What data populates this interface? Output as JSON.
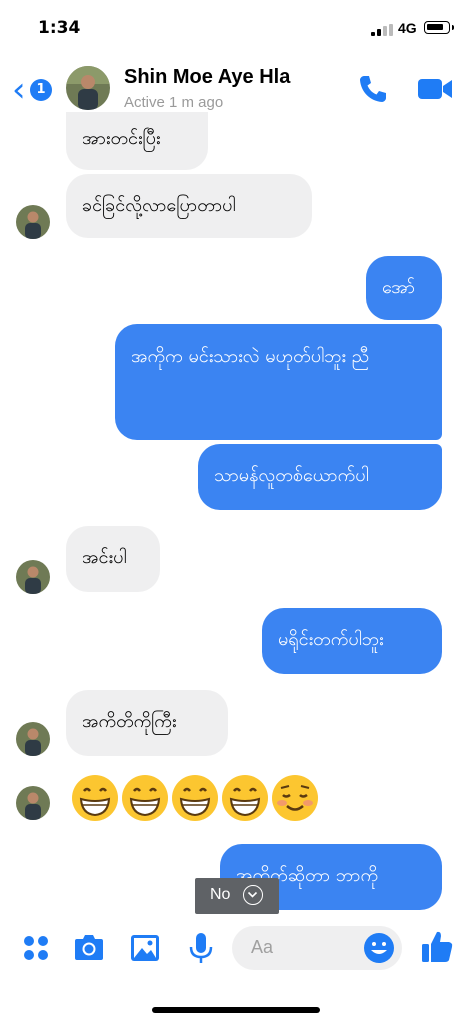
{
  "status_bar": {
    "time": "1:34",
    "network": "4G"
  },
  "header": {
    "back_badge": "1",
    "contact_name": "Shin Moe Aye Hla",
    "contact_status": "Active 1 m ago"
  },
  "messages": [
    {
      "side": "in",
      "text": "အားတင်းပြီး"
    },
    {
      "side": "in",
      "text": "ခင်ခြင်လို့လာပြောတာပါ"
    },
    {
      "side": "out",
      "text": "အော်"
    },
    {
      "side": "out",
      "text": "အကိုက မင်းသားလဲ မဟုတ်ပါဘူး ညီ"
    },
    {
      "side": "out",
      "text": "သာမန်လူတစ်ယောက်ပါ"
    },
    {
      "side": "in",
      "text": "အင်းပါ"
    },
    {
      "side": "out",
      "text": "မရိုင်းတက်ပါဘူး"
    },
    {
      "side": "in",
      "text": "အကိတိကိုကြီး"
    },
    {
      "side": "in",
      "emoji": [
        "grinning",
        "grinning",
        "grinning",
        "grinning",
        "smiling-blush"
      ]
    },
    {
      "side": "out",
      "text": "အကိတ်ဆိုတာ ဘာကို"
    }
  ],
  "toast": {
    "label": "No"
  },
  "composer": {
    "placeholder": "Aa"
  },
  "colors": {
    "accent": "#1f7cf5",
    "outgoing_bubble": "#3b84f2",
    "incoming_bubble": "#efeff0"
  }
}
